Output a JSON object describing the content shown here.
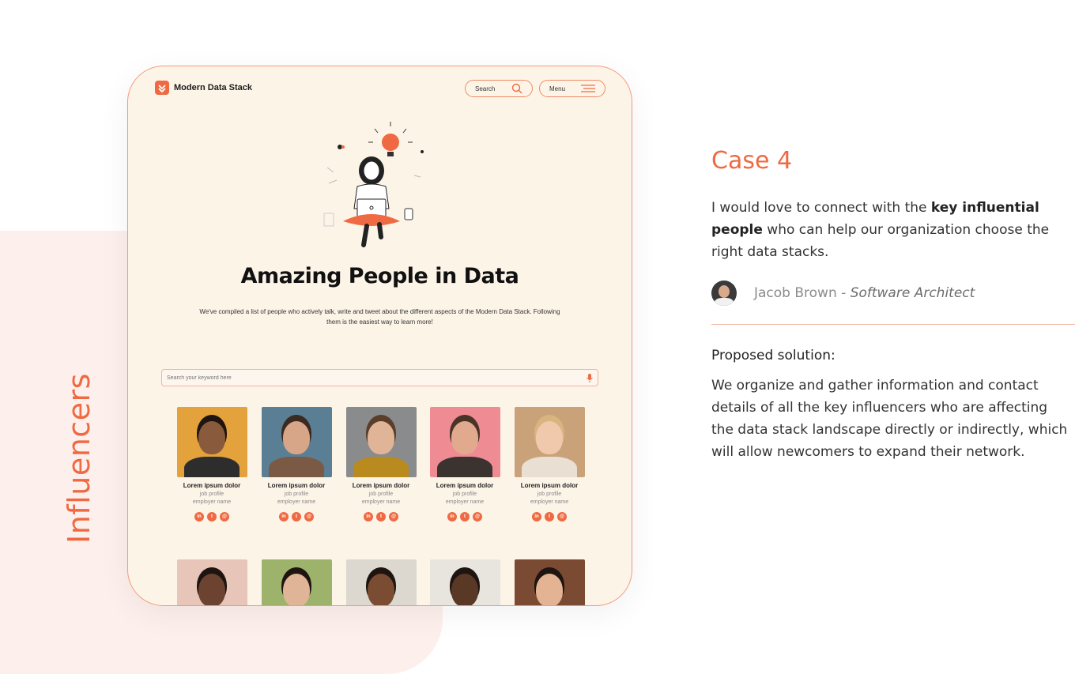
{
  "section_label": "Influencers",
  "app": {
    "brand": "Modern Data Stack",
    "nav": {
      "search_label": "Search",
      "menu_label": "Menu"
    },
    "hero": {
      "title": "Amazing People in Data",
      "subtitle": "We've compiled a list of people who actively talk, write and tweet about the different aspects of the Modern Data Stack. Following them is the easiest way to learn more!"
    },
    "keyword_search": {
      "placeholder": "Search your keyword here"
    },
    "cards": [
      {
        "name": "Lorem ipsum dolor",
        "job": "job profile",
        "employer": "employer name",
        "bg": "#e3a23b",
        "skin": "#8a5a3c",
        "cloth": "#2d2d2d",
        "hair": "#1e1410"
      },
      {
        "name": "Lorem ipsum dolor",
        "job": "job profile",
        "employer": "employer name",
        "bg": "#5a7f94",
        "skin": "#d7a587",
        "cloth": "#7b5a45",
        "hair": "#3a2a20"
      },
      {
        "name": "Lorem ipsum dolor",
        "job": "job profile",
        "employer": "employer name",
        "bg": "#8a8b8d",
        "skin": "#e0b497",
        "cloth": "#b98a1e",
        "hair": "#5a3e2a"
      },
      {
        "name": "Lorem ipsum dolor",
        "job": "job profile",
        "employer": "employer name",
        "bg": "#ef8c93",
        "skin": "#e1aa8e",
        "cloth": "#3b3330",
        "hair": "#4a3428"
      },
      {
        "name": "Lorem ipsum dolor",
        "job": "job profile",
        "employer": "employer name",
        "bg": "#c9a27a",
        "skin": "#f0c9ad",
        "cloth": "#e9dfd2",
        "hair": "#d8b57e"
      }
    ],
    "cards_row2": [
      {
        "bg": "#e7c5b8",
        "skin": "#6b4330",
        "cloth": "#f2e9e2"
      },
      {
        "bg": "#9db36b",
        "skin": "#e0b497",
        "cloth": "#d8c3a7"
      },
      {
        "bg": "#ddd8cf",
        "skin": "#7a4c32",
        "cloth": "#e2a25e"
      },
      {
        "bg": "#e8e5df",
        "skin": "#5a3826",
        "cloth": "#2f3440"
      },
      {
        "bg": "#7b4a32",
        "skin": "#e4b393",
        "cloth": "#8fa4c8"
      }
    ],
    "social_icons": [
      "linkedin-icon",
      "twitter-icon",
      "website-icon"
    ]
  },
  "case": {
    "title": "Case 4",
    "quote_pre": "I would love to connect with the ",
    "quote_bold": "key influential people",
    "quote_post": " who can help our organization choose the right data stacks.",
    "author_name": "Jacob Brown - ",
    "author_role": "Software Architect",
    "proposed_heading": "Proposed solution:",
    "solution": "We organize and gather information and contact details of all the key influencers who are affecting the data stack landscape directly or indirectly, which will allow newcomers to expand their network."
  },
  "colors": {
    "accent": "#ef6a42",
    "panel_bg": "#fdf4e8",
    "backdrop": "#fdf0ec"
  }
}
